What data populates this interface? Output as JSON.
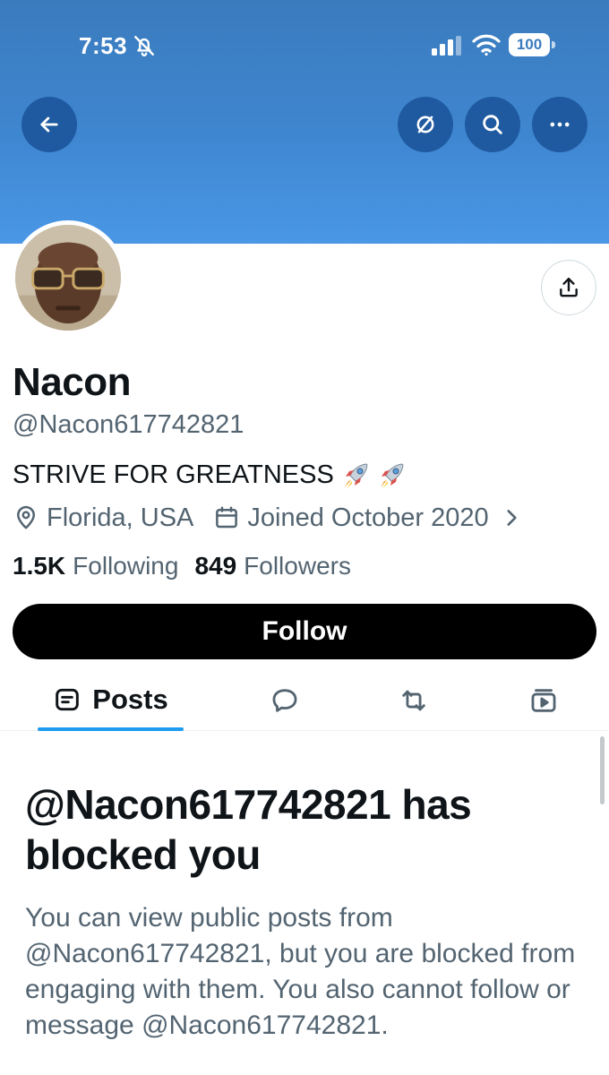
{
  "status_bar": {
    "time": "7:53",
    "battery": "100"
  },
  "header": {
    "back_label": "Back",
    "actions": [
      "Muted/Hidden",
      "Search",
      "More"
    ]
  },
  "profile": {
    "display_name": "Nacon",
    "handle": "@Nacon617742821",
    "bio": "STRIVE FOR GREATNESS",
    "bio_emoji": [
      "rocket",
      "rocket"
    ],
    "location": "Florida, USA",
    "joined": "Joined October 2020",
    "following_count": "1.5K",
    "following_label": "Following",
    "followers_count": "849",
    "followers_label": "Followers"
  },
  "follow_button_label": "Follow",
  "tabs": {
    "posts_label": "Posts",
    "icons": [
      "posts-icon",
      "replies-icon",
      "reposts-icon",
      "media-icon"
    ]
  },
  "blocked_notice": {
    "title": "@Nacon617742821 has blocked you",
    "body": "You can view public posts from @Nacon617742821, but you are blocked from engaging with them. You also cannot follow or message @Nacon617742821."
  },
  "colors": {
    "banner": "#3f86d0",
    "header_button": "#1f5aa0",
    "tab_accent": "#1d9bf0",
    "secondary_text": "#536471",
    "follow_button": "#000000"
  }
}
